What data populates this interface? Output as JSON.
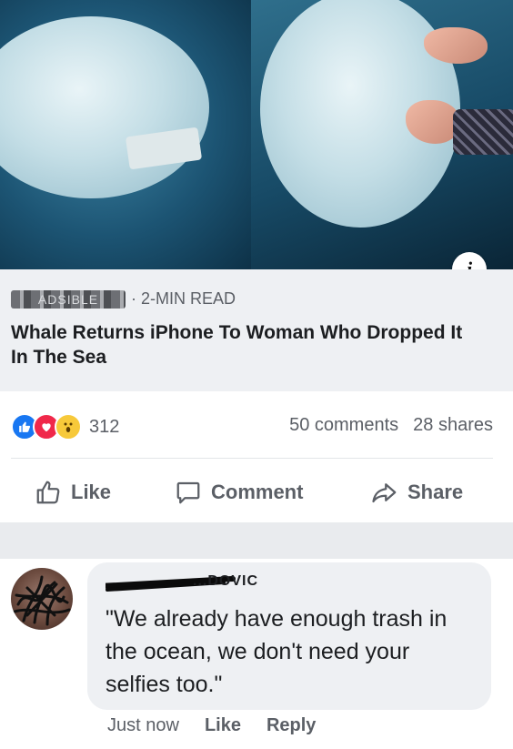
{
  "link_preview": {
    "source": "ADSIBLE",
    "read_time": "· 2-MIN READ",
    "headline": "Whale Returns iPhone To Woman Who Dropped It In The Sea",
    "info_label": "i"
  },
  "reactions": {
    "icons": [
      "like-reaction-icon",
      "love-reaction-icon",
      "wow-reaction-icon"
    ],
    "count": "312"
  },
  "stats": {
    "comments": "50 comments",
    "shares": "28 shares"
  },
  "actions": {
    "like": "Like",
    "comment": "Comment",
    "share": "Share"
  },
  "comment": {
    "author": "...DOVIC",
    "text": "\"We already have enough trash in the ocean, we don't need your selfies too.\"",
    "time": "Just now",
    "like": "Like",
    "reply": "Reply"
  },
  "colors": {
    "brand_blue": "#1877f2",
    "love_red": "#f0284a",
    "wow_yellow": "#f7c93a",
    "muted_text": "#5b5f66",
    "preview_bg": "#eef0f3"
  }
}
